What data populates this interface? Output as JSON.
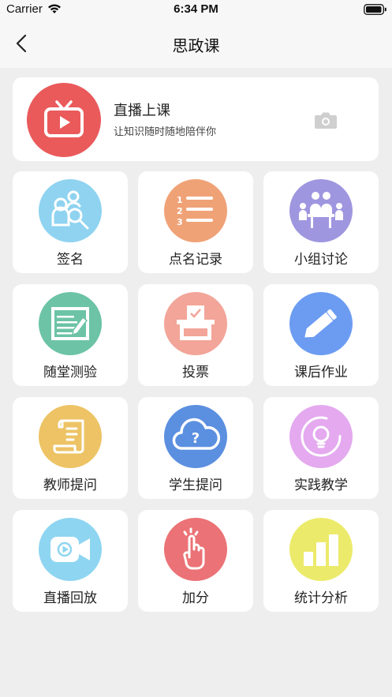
{
  "status_bar": {
    "carrier": "Carrier",
    "time": "6:34 PM"
  },
  "nav": {
    "title": "思政课",
    "back_icon": "chevron-left-icon"
  },
  "live": {
    "title": "直播上课",
    "subtitle": "让知识随时随地陪伴你",
    "icon": "tv-icon",
    "color": "#ea5a5b"
  },
  "tiles": [
    {
      "label": "签名",
      "icon": "people-search-icon",
      "color": "#8fd3f0"
    },
    {
      "label": "点名记录",
      "icon": "numbered-list-icon",
      "color": "#f0a277"
    },
    {
      "label": "小组讨论",
      "icon": "group-discussion-icon",
      "color": "#9f96e0"
    },
    {
      "label": "随堂测验",
      "icon": "quiz-board-icon",
      "color": "#6cc3a6"
    },
    {
      "label": "投票",
      "icon": "ballot-box-icon",
      "color": "#f2a598"
    },
    {
      "label": "课后作业",
      "icon": "pencil-icon",
      "color": "#6c9cf2"
    },
    {
      "label": "教师提问",
      "icon": "scroll-icon",
      "color": "#edc365"
    },
    {
      "label": "学生提问",
      "icon": "question-cloud-icon",
      "color": "#5b8fe0"
    },
    {
      "label": "实践教学",
      "icon": "lightbulb-icon",
      "color": "#e4a9ef"
    },
    {
      "label": "直播回放",
      "icon": "video-camera-icon",
      "color": "#8ed5f1"
    },
    {
      "label": "加分",
      "icon": "hand-tap-icon",
      "color": "#eb7276"
    },
    {
      "label": "统计分析",
      "icon": "bar-chart-icon",
      "color": "#ecea6a"
    }
  ]
}
